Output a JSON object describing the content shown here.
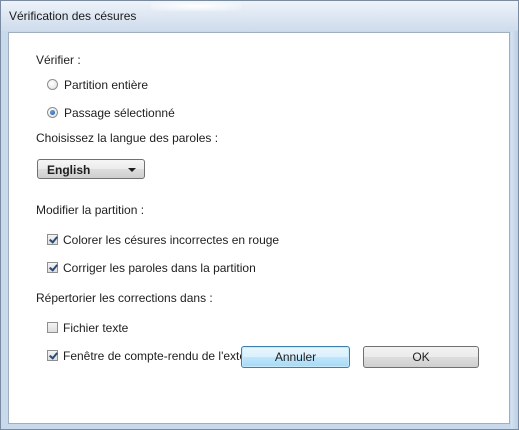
{
  "window": {
    "title": "Vérification des césures"
  },
  "verify": {
    "label": "Vérifier :",
    "options": [
      {
        "label": "Partition entière",
        "selected": false
      },
      {
        "label": "Passage sélectionné",
        "selected": true
      }
    ]
  },
  "language": {
    "label": "Choisissez la langue des paroles :",
    "selected": "English"
  },
  "modify": {
    "label": "Modifier la partition :",
    "options": [
      {
        "label": "Colorer les césures incorrectes en rouge",
        "checked": true
      },
      {
        "label": "Corriger les paroles dans la partition",
        "checked": true
      }
    ]
  },
  "report": {
    "label": "Répertorier les corrections dans :",
    "options": [
      {
        "label": "Fichier texte",
        "checked": false
      },
      {
        "label": "Fenêtre de compte-rendu de l'extension",
        "checked": true
      }
    ]
  },
  "buttons": {
    "cancel": "Annuler",
    "ok": "OK"
  }
}
